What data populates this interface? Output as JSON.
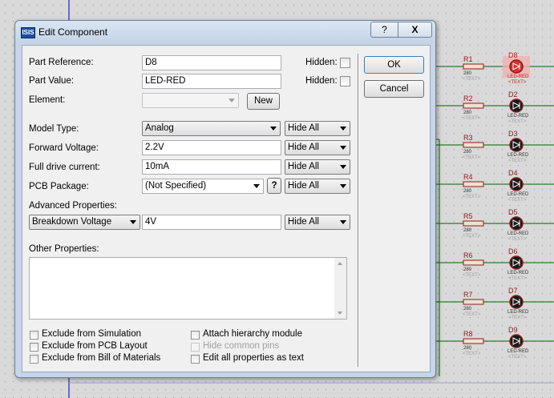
{
  "window": {
    "title": "Edit Component",
    "app_icon": "ISIS"
  },
  "titlebar": {
    "help_label": "?",
    "close_label": "X"
  },
  "labels": {
    "part_reference": "Part Reference:",
    "part_value": "Part Value:",
    "element": "Element:",
    "model_type": "Model Type:",
    "forward_voltage": "Forward Voltage:",
    "full_drive_current": "Full drive current:",
    "pcb_package": "PCB Package:",
    "advanced_properties": "Advanced Properties:",
    "other_properties": "Other Properties:",
    "hidden": "Hidden:"
  },
  "fields": {
    "part_reference": "D8",
    "part_value": "LED-RED",
    "element": "",
    "model_type": "Analog",
    "forward_voltage": "2.2V",
    "full_drive_current": "10mA",
    "pcb_package": "(Not Specified)",
    "advanced_property": "Breakdown Voltage",
    "advanced_value": "4V",
    "other_properties": ""
  },
  "visibility_options": {
    "model_type": "Hide All",
    "forward_voltage": "Hide All",
    "full_drive_current": "Hide All",
    "pcb_package": "Hide All",
    "advanced": "Hide All"
  },
  "buttons": {
    "new": "New",
    "ok": "OK",
    "cancel": "Cancel",
    "pcb_help": "?"
  },
  "checkboxes": {
    "exclude_simulation": "Exclude from Simulation",
    "exclude_pcb": "Exclude from PCB Layout",
    "exclude_bom": "Exclude from Bill of Materials",
    "attach_hierarchy": "Attach hierarchy module",
    "hide_common_pins": "Hide common pins",
    "edit_all_text": "Edit all properties as text"
  },
  "schematic": {
    "rows": [
      {
        "resistor": "R1",
        "value": "280",
        "text": "<TEXT>",
        "led": "D8",
        "led_value": "LED-RED",
        "led_text": "<TEXT>"
      },
      {
        "resistor": "R2",
        "value": "280",
        "text": "<TEXT>",
        "led": "D2",
        "led_value": "LED-RED",
        "led_text": "<TEXT>"
      },
      {
        "resistor": "R3",
        "value": "280",
        "text": "<TEXT>",
        "led": "D3",
        "led_value": "LED-RED",
        "led_text": "<TEXT>"
      },
      {
        "resistor": "R4",
        "value": "280",
        "text": "<TEXT>",
        "led": "D4",
        "led_value": "LED-RED",
        "led_text": "<TEXT>"
      },
      {
        "resistor": "R5",
        "value": "280",
        "text": "<TEXT>",
        "led": "D5",
        "led_value": "LED-RED",
        "led_text": "<TEXT>"
      },
      {
        "resistor": "R6",
        "value": "280",
        "text": "<TEXT>",
        "led": "D6",
        "led_value": "LED-RED",
        "led_text": "<TEXT>"
      },
      {
        "resistor": "R7",
        "value": "280",
        "text": "<TEXT>",
        "led": "D7",
        "led_value": "LED-RED",
        "led_text": "<TEXT>"
      },
      {
        "resistor": "R8",
        "value": "280",
        "text": "<TEXT>",
        "led": "D9",
        "led_value": "LED-RED",
        "led_text": "<TEXT>"
      }
    ],
    "selected_led_color": "#d93030",
    "wire_color": "#006400",
    "part_color": "#8b1a1a",
    "text_color": "#a0a0a0"
  }
}
